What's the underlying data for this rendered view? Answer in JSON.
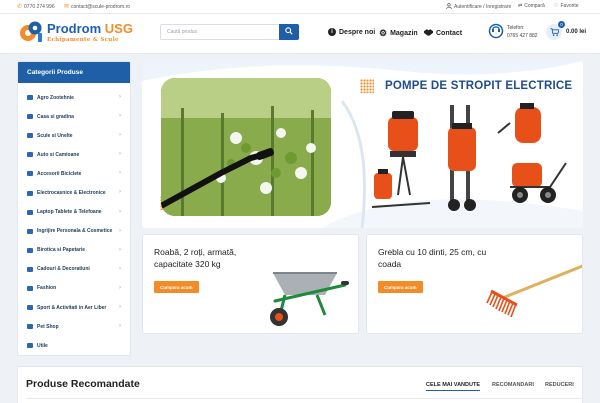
{
  "topbar": {
    "phone": "0770 274 996",
    "email": "contact@scule-prodrom.ro",
    "auth": "Autentificare / Inregistrare",
    "compare": "Compară",
    "favorites": "Favorite"
  },
  "header": {
    "logo_name": "Prodrom",
    "logo_name_accent": "USG",
    "logo_tagline": "Echipamente & Scule",
    "search_placeholder": "Caută produs",
    "nav": [
      {
        "label": "Despre noi",
        "icon": "info-icon"
      },
      {
        "label": "Magazin",
        "icon": "gear-icon"
      },
      {
        "label": "Contact",
        "icon": "handshake-icon"
      }
    ],
    "phone_label": "Telefon:",
    "phone_number": "0765 427 882",
    "cart_count": "0",
    "cart_total": "0.00 lei"
  },
  "sidebar": {
    "title": "Categorii Produse",
    "items": [
      {
        "label": "Agro Zootehnie"
      },
      {
        "label": "Casa si gradina"
      },
      {
        "label": "Scule si Unelte"
      },
      {
        "label": "Auto si Camioane"
      },
      {
        "label": "Accesorii Biciclete"
      },
      {
        "label": "Electrocasnice & Electronice"
      },
      {
        "label": "Laptop Tablete & Telefoane"
      },
      {
        "label": "Ingrijire Personala & Cosmetice"
      },
      {
        "label": "Birotica si Papetarie"
      },
      {
        "label": "Cadouri & Decoratiuni"
      },
      {
        "label": "Fashion"
      },
      {
        "label": "Sport & Activitati in Aer Liber"
      },
      {
        "label": "Pet Shop"
      },
      {
        "label": "Utile"
      }
    ]
  },
  "hero": {
    "title": "POMPE DE STROPIT ELECTRICE"
  },
  "promos": [
    {
      "title": "Roabă, 2 roți, armată, capacitate 320 kg",
      "button": "Cumpara acum"
    },
    {
      "title": "Grebla cu 10 dinti, 25 cm, cu coada",
      "button": "Cumpara acum"
    }
  ],
  "recommended": {
    "title": "Produse Recomandate",
    "tabs": [
      "CELE MAI VANDUTE",
      "RECOMANDARI",
      "REDUCERI"
    ]
  },
  "colors": {
    "brand_blue": "#1e5fa8",
    "accent_orange": "#f28c28"
  }
}
